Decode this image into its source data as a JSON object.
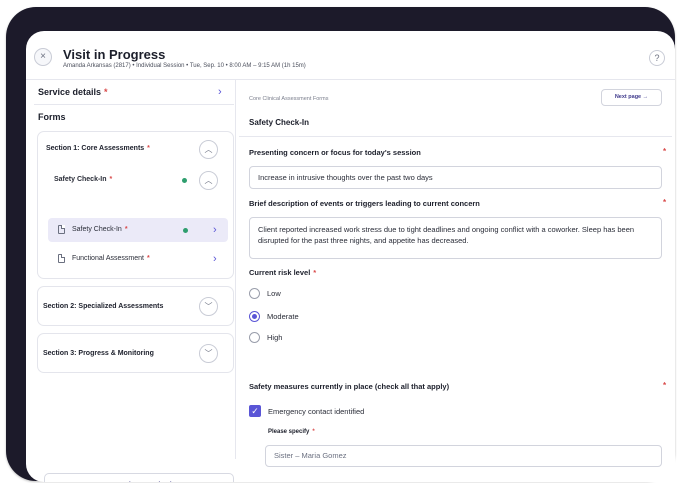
{
  "header": {
    "title": "Visit in Progress",
    "subtitle": "Amanda Arkansas (2817) • Individual Session • Tue, Sep. 10 • 8:00 AM – 9:15 AM (1h 15m)",
    "close_glyph": "×",
    "help_glyph": "?"
  },
  "sidebar": {
    "service_details": "Service details",
    "required_mark": "*",
    "forms_label": "Forms",
    "sections": [
      {
        "title": "Section 1: Core Assessments",
        "expanded": true
      },
      {
        "title": "Section 2: Specialized Assessments",
        "expanded": false
      },
      {
        "title": "Section 3: Progress & Monitoring",
        "expanded": false
      }
    ],
    "subsection": {
      "label": "Safety Check-In",
      "status_color": "#2e9e6e"
    },
    "form_items": [
      {
        "label": "Safety Check-In",
        "active": true
      },
      {
        "label": "Functional Assessment",
        "active": false
      }
    ],
    "next_button": "Next: sign & submit"
  },
  "main": {
    "breadcrumb": "Core Clinical Assessment Forms",
    "next_page": "Next page",
    "form_title": "Safety Check-In",
    "q1": {
      "label": "Presenting concern or focus for today's session",
      "value": "Increase in intrusive thoughts over the past two days"
    },
    "q2": {
      "label": "Brief description of events or triggers leading to current concern",
      "value": "Client reported increased work stress due to tight deadlines and ongoing conflict with a coworker. Sleep has been disrupted for the past three nights, and appetite has decreased."
    },
    "q3": {
      "label": "Current risk level",
      "options": [
        "Low",
        "Moderate",
        "High"
      ],
      "selected": "Moderate"
    },
    "q4": {
      "label": "Safety measures currently in place (check all that apply)",
      "checked_item": "Emergency contact identified",
      "specify_label": "Please specify",
      "specify_value": "Sister – Maria Gomez"
    }
  },
  "colors": {
    "accent": "#5a55d6",
    "required": "#d94a4a",
    "complete": "#2e9e6e",
    "frame": "#1c1a2a"
  }
}
